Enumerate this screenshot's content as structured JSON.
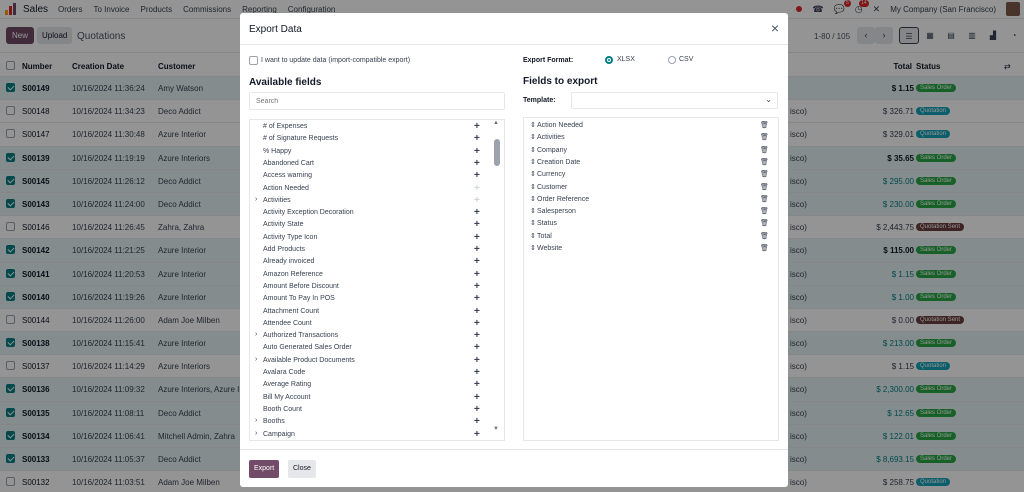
{
  "topbar": {
    "app_name": "Sales",
    "menu": [
      "Orders",
      "To Invoice",
      "Products",
      "Commissions",
      "Reporting",
      "Configuration"
    ],
    "activity_badge": "5",
    "messages_badge": "14",
    "company": "My Company (San Francisco)"
  },
  "control": {
    "new_label": "New",
    "upload_label": "Upload",
    "title": "Quotations",
    "pager": "1-80 / 105"
  },
  "table": {
    "headers": {
      "number": "Number",
      "creation_date": "Creation Date",
      "customer": "Customer",
      "total": "Total",
      "status": "Status"
    },
    "rows": [
      {
        "number": "S00149",
        "date": "10/16/2024 11:36:24",
        "customer": "Amy Watson",
        "extra": "",
        "total": "$ 1.15",
        "status": "Sales Order",
        "selected": true
      },
      {
        "number": "S00148",
        "date": "10/16/2024 11:34:23",
        "customer": "Deco Addict",
        "extra": "isco)",
        "total": "$ 326.71",
        "status": "Quotation",
        "selected": false
      },
      {
        "number": "S00147",
        "date": "10/16/2024 11:30:48",
        "customer": "Azure Interior",
        "extra": "isco)",
        "total": "$ 329.01",
        "status": "Quotation",
        "selected": false
      },
      {
        "number": "S00139",
        "date": "10/16/2024 11:19:19",
        "customer": "Azure Interiors",
        "extra": "isco)",
        "total": "$ 35.65",
        "status": "Sales Order",
        "selected": true
      },
      {
        "number": "S00145",
        "date": "10/16/2024 11:26:12",
        "customer": "Deco Addict",
        "extra": "isco)",
        "total": "$ 295.00",
        "status": "Sales Order",
        "selected": true
      },
      {
        "number": "S00143",
        "date": "10/16/2024 11:24:00",
        "customer": "Deco Addict",
        "extra": "isco)",
        "total": "$ 230.00",
        "status": "Sales Order",
        "selected": true
      },
      {
        "number": "S00146",
        "date": "10/16/2024 11:26:45",
        "customer": "Zahra, Zahra",
        "extra": "isco)",
        "total": "$ 2,443.75",
        "status": "Quotation Sent",
        "selected": false
      },
      {
        "number": "S00142",
        "date": "10/16/2024 11:21:25",
        "customer": "Azure Interior",
        "extra": "isco)",
        "total": "$ 115.00",
        "status": "Sales Order",
        "selected": true
      },
      {
        "number": "S00141",
        "date": "10/16/2024 11:20:53",
        "customer": "Azure Interior",
        "extra": "isco)",
        "total": "$ 1.15",
        "status": "Sales Order",
        "selected": true
      },
      {
        "number": "S00140",
        "date": "10/16/2024 11:19:26",
        "customer": "Azure Interior",
        "extra": "isco)",
        "total": "$ 1.00",
        "status": "Sales Order",
        "selected": true
      },
      {
        "number": "S00144",
        "date": "10/16/2024 11:26:00",
        "customer": "Adam Joe Milben",
        "extra": "isco)",
        "total": "$ 0.00",
        "status": "Quotation Sent",
        "selected": false
      },
      {
        "number": "S00138",
        "date": "10/16/2024 11:15:41",
        "customer": "Azure Interior",
        "extra": "isco)",
        "total": "$ 213.00",
        "status": "Sales Order",
        "selected": true
      },
      {
        "number": "S00137",
        "date": "10/16/2024 11:14:29",
        "customer": "Azure Interiors",
        "extra": "isco)",
        "total": "$ 1.15",
        "status": "Quotation",
        "selected": false
      },
      {
        "number": "S00136",
        "date": "10/16/2024 11:09:32",
        "customer": "Azure Interiors, Azure In",
        "extra": "isco)",
        "total": "$ 2,300.00",
        "status": "Sales Order",
        "selected": true
      },
      {
        "number": "S00135",
        "date": "10/16/2024 11:08:11",
        "customer": "Deco Addict",
        "extra": "isco)",
        "total": "$ 12.65",
        "status": "Sales Order",
        "selected": true
      },
      {
        "number": "S00134",
        "date": "10/16/2024 11:06:41",
        "customer": "Mitchell Admin, Zahra",
        "extra": "isco)",
        "total": "$ 122.01",
        "status": "Sales Order",
        "selected": true
      },
      {
        "number": "S00133",
        "date": "10/16/2024 11:05:37",
        "customer": "Deco Addict",
        "extra": "isco)",
        "total": "$ 8,693.15",
        "status": "Sales Order",
        "selected": true
      },
      {
        "number": "S00132",
        "date": "10/16/2024 11:03:51",
        "customer": "Adam Joe Milben",
        "extra": "isco)",
        "total": "$ 258.75",
        "status": "Quotation",
        "selected": false
      }
    ]
  },
  "modal": {
    "title": "Export Data",
    "import_compat_label": "I want to update data (import-compatible export)",
    "available_fields_heading": "Available fields",
    "search_placeholder": "Search",
    "available_fields": [
      {
        "label": "# of Expenses",
        "expandable": false,
        "addable": true
      },
      {
        "label": "# of Signature Requests",
        "expandable": false,
        "addable": true
      },
      {
        "label": "% Happy",
        "expandable": false,
        "addable": true
      },
      {
        "label": "Abandoned Cart",
        "expandable": false,
        "addable": true
      },
      {
        "label": "Access warning",
        "expandable": false,
        "addable": true
      },
      {
        "label": "Action Needed",
        "expandable": false,
        "addable": false
      },
      {
        "label": "Activities",
        "expandable": true,
        "addable": false
      },
      {
        "label": "Activity Exception Decoration",
        "expandable": false,
        "addable": true
      },
      {
        "label": "Activity State",
        "expandable": false,
        "addable": true
      },
      {
        "label": "Activity Type Icon",
        "expandable": false,
        "addable": true
      },
      {
        "label": "Add Products",
        "expandable": false,
        "addable": true
      },
      {
        "label": "Already invoiced",
        "expandable": false,
        "addable": true
      },
      {
        "label": "Amazon Reference",
        "expandable": false,
        "addable": true
      },
      {
        "label": "Amount Before Discount",
        "expandable": false,
        "addable": true
      },
      {
        "label": "Amount To Pay In POS",
        "expandable": false,
        "addable": true
      },
      {
        "label": "Attachment Count",
        "expandable": false,
        "addable": true
      },
      {
        "label": "Attendee Count",
        "expandable": false,
        "addable": true
      },
      {
        "label": "Authorized Transactions",
        "expandable": true,
        "addable": true
      },
      {
        "label": "Auto Generated Sales Order",
        "expandable": false,
        "addable": true
      },
      {
        "label": "Available Product Documents",
        "expandable": true,
        "addable": true
      },
      {
        "label": "Avalara Code",
        "expandable": false,
        "addable": true
      },
      {
        "label": "Average Rating",
        "expandable": false,
        "addable": true
      },
      {
        "label": "Bill My Account",
        "expandable": false,
        "addable": true
      },
      {
        "label": "Booth Count",
        "expandable": false,
        "addable": true
      },
      {
        "label": "Booths",
        "expandable": true,
        "addable": true
      },
      {
        "label": "Campaign",
        "expandable": true,
        "addable": true
      }
    ],
    "export_format_label": "Export Format:",
    "format_xlsx": "XLSX",
    "format_csv": "CSV",
    "fields_to_export_heading": "Fields to export",
    "template_label": "Template:",
    "template_value": "",
    "fields_to_export": [
      "Action Needed",
      "Activities",
      "Company",
      "Creation Date",
      "Currency",
      "Customer",
      "Order Reference",
      "Salesperson",
      "Status",
      "Total",
      "Website"
    ],
    "export_button": "Export",
    "close_button": "Close"
  },
  "colors": {
    "brand": "#714b67",
    "accent": "#017e84",
    "sales_order": "#28a745",
    "quotation": "#17a2b8",
    "quotation_sent": "#6b3f3f"
  }
}
